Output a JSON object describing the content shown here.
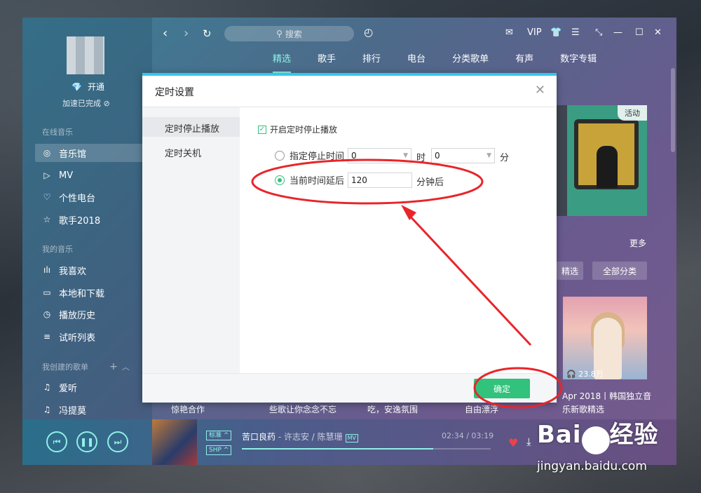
{
  "window": {
    "nav_back": "‹",
    "nav_forward": "›",
    "refresh": "↻",
    "search_placeholder": "搜索",
    "vip": "VIP"
  },
  "user": {
    "open_vip": "开通",
    "speed_status": "加速已完成"
  },
  "sidebar": {
    "online_section": "在线音乐",
    "online_items": [
      {
        "label": "音乐馆",
        "icon": "music-hall-icon"
      },
      {
        "label": "MV",
        "icon": "mv-icon"
      },
      {
        "label": "个性电台",
        "icon": "radio-heart-icon"
      },
      {
        "label": "歌手2018",
        "icon": "star-icon"
      }
    ],
    "my_section": "我的音乐",
    "my_items": [
      {
        "label": "我喜欢",
        "icon": "bars-icon"
      },
      {
        "label": "本地和下载",
        "icon": "monitor-icon"
      },
      {
        "label": "播放历史",
        "icon": "clock-icon"
      },
      {
        "label": "试听列表",
        "icon": "list-icon"
      }
    ],
    "created_section": "我创建的歌单",
    "playlists": [
      {
        "label": "爱听"
      },
      {
        "label": "冯提莫"
      }
    ]
  },
  "tabs": [
    "精选",
    "歌手",
    "排行",
    "电台",
    "分类歌单",
    "有声",
    "数字专辑"
  ],
  "content": {
    "badge": "活动",
    "more": "更多",
    "pill_left": "精选",
    "pill_right": "全部分类",
    "plays": "23.8万",
    "photo_caption_1": "Apr 2018丨韩国独立音",
    "photo_caption_2": "乐新歌精选",
    "bottom_captions": [
      "惊艳合作",
      "些歌让你念念不忘",
      "吃，安逸氛围",
      "自由漂浮"
    ]
  },
  "player": {
    "quality": "标准 ^",
    "effect": "SHP ^",
    "song": "苦口良药",
    "artist": " - 许志安 / 陈慧珊",
    "mv": "MV",
    "time": "02:34 / 03:19",
    "progress": 0.77
  },
  "dialog": {
    "title": "定时设置",
    "side_items": [
      "定时停止播放",
      "定时关机"
    ],
    "enable_label": "开启定时停止播放",
    "opt1_label": "指定停止时间",
    "hour_value": "0",
    "hour_unit": "时",
    "minute_value": "0",
    "minute_unit": "分",
    "opt2_label": "当前时间延后",
    "delay_value": "120",
    "delay_unit": "分钟后",
    "ok": "确定"
  },
  "watermark": {
    "brand": "Bai",
    "brand2": "经验",
    "url": "jingyan.baidu.com"
  },
  "colors": {
    "accent": "#31c27c",
    "annotation": "#e8252a",
    "teal": "#8ff0e6"
  }
}
